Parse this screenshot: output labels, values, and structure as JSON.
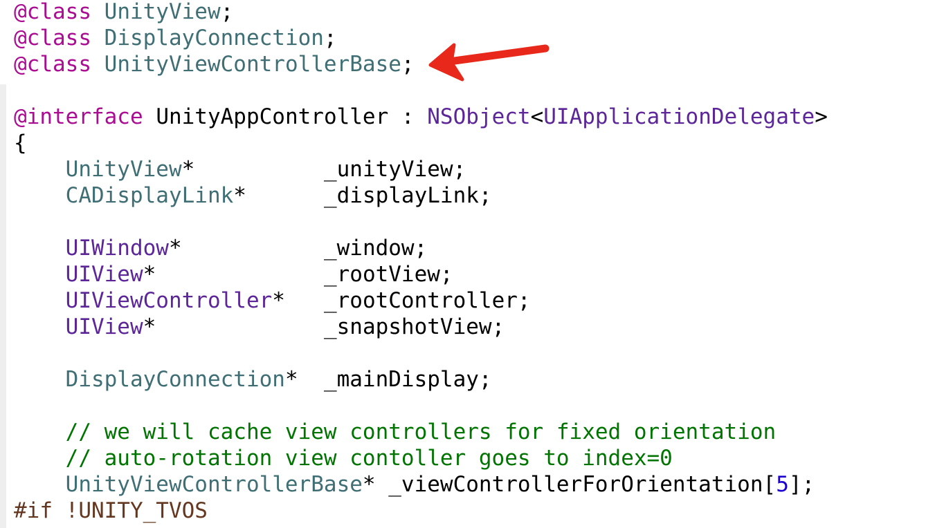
{
  "code": {
    "class_keyword": "@class",
    "class_decls": [
      "UnityView",
      "DisplayConnection",
      "UnityViewControllerBase"
    ],
    "semicolon": ";",
    "interface_keyword": "@interface",
    "interface_name": "UnityAppController",
    "colon": " : ",
    "superclass": "NSObject",
    "lt": "<",
    "protocol": "UIApplicationDelegate",
    "gt": ">",
    "open_brace": "{",
    "ivars": [
      {
        "type": "UnityView",
        "star": "*",
        "name": "_unityView;"
      },
      {
        "type": "CADisplayLink",
        "star": "*",
        "name": "_displayLink;"
      },
      {
        "type": "UIWindow",
        "star": "*",
        "name": "_window;"
      },
      {
        "type": "UIView",
        "star": "*",
        "name": "_rootView;"
      },
      {
        "type": "UIViewController",
        "star": "*",
        "name": "_rootController;"
      },
      {
        "type": "UIView",
        "star": "*",
        "name": "_snapshotView;"
      },
      {
        "type": "DisplayConnection",
        "star": "*",
        "name": "_mainDisplay;"
      }
    ],
    "comments": [
      "// we will cache view controllers for fixed orientation",
      "// auto-rotation view contoller goes to index=0"
    ],
    "array_ivar": {
      "type": "UnityViewControllerBase",
      "star": "*",
      "name": " _viewControllerForOrientation",
      "open_bracket": "[",
      "size": "5",
      "close": "];"
    },
    "preprocessor": "#if !UNITY_TVOS"
  },
  "colors": {
    "keyword": "#aa0d91",
    "project_type": "#3f6e74",
    "system_type": "#5c2699",
    "comment": "#007400",
    "preprocessor": "#643820",
    "number": "#1c00cf",
    "annotation_arrow": "#e8281a"
  },
  "annotation": {
    "icon": "red-arrow-icon",
    "points_to_line": 3
  }
}
